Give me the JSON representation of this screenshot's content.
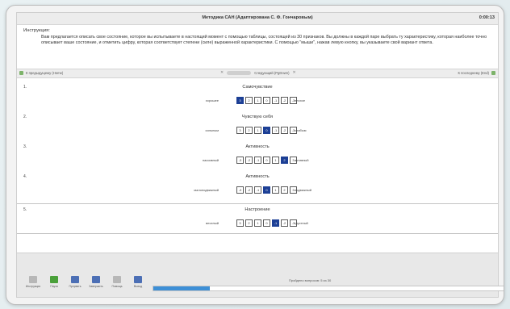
{
  "window": {
    "title": "Методика САН (Адаптирована С. Ф. Гончаровым)",
    "timer": "0:00:13"
  },
  "instructions": {
    "heading": "Инструкция:",
    "text": "Вам предлагается описать свое состояние, которое вы испытываете в настоящий момент с помощью таблицы, состоящей из 30 признаков. Вы должны в каждой паре выбрать ту характеристику, которая наиболее точно описывает ваше состояние, и отметить цифру, которая соответствует степени (силе) выраженной характеристики. С помощью \"мыши\", нажав левую кнопку, вы указываете свой вариант ответа."
  },
  "nav": {
    "left_label": "К предыдущему (Home)",
    "mid_label": "Следующий (PgDown)",
    "right_label": "К последнему (End)"
  },
  "questions": [
    {
      "number": "1.",
      "title": "Самочувствие",
      "left_word": "хорошее",
      "right_word": "плохое",
      "scale": [
        "3",
        "2",
        "1",
        "0",
        "-1",
        "-2",
        "-3"
      ],
      "selected": 0
    },
    {
      "number": "2.",
      "title": "Чувствую себя",
      "left_word": "сильным",
      "right_word": "слабым",
      "scale": [
        "3",
        "2",
        "1",
        "0",
        "-1",
        "-2",
        "-3"
      ],
      "selected": 3
    },
    {
      "number": "3.",
      "title": "Активность",
      "left_word": "пассивный",
      "right_word": "активный",
      "scale": [
        "-3",
        "-2",
        "-1",
        "0",
        "1",
        "2",
        "3"
      ],
      "selected": 5
    },
    {
      "number": "4.",
      "title": "Активность",
      "left_word": "малоподвижный",
      "right_word": "подвижный",
      "scale": [
        "-3",
        "-2",
        "-1",
        "0",
        "1",
        "2",
        "3"
      ],
      "selected": 3
    },
    {
      "number": "5.",
      "title": "Настроение",
      "left_word": "веселый",
      "right_word": "грустный",
      "scale": [
        "3",
        "2",
        "1",
        "0",
        "-1",
        "-2",
        "-3"
      ],
      "selected": 4
    }
  ],
  "toolbar": [
    {
      "label": "Инструкция",
      "icon": "info-icon",
      "color": "#b7b7b7"
    },
    {
      "label": "Пауза",
      "icon": "pause-icon",
      "color": "#4aa03a"
    },
    {
      "label": "Прервать",
      "icon": "stop-icon",
      "color": "#4c6fb5"
    },
    {
      "label": "Завершить",
      "icon": "finish-icon",
      "color": "#4c6fb5"
    },
    {
      "label": "Помощь",
      "icon": "help-icon",
      "color": "#b7b7b7"
    },
    {
      "label": "Выход",
      "icon": "exit-icon",
      "color": "#4c6fb5"
    }
  ],
  "progress": {
    "text": "Пройдено вопросов: 5 из 30",
    "value": 0.16
  }
}
